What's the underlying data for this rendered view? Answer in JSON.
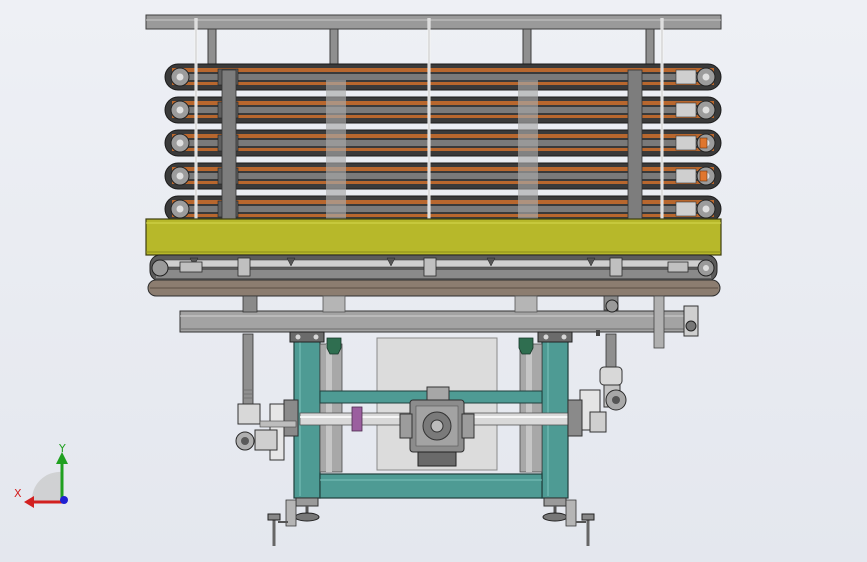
{
  "viewport": {
    "background_top": "#eef0f5",
    "background_bottom": "#e4e7ee"
  },
  "colors": {
    "frame_gray": "#8f8f8f",
    "frame_dark": "#4a4a4a",
    "belt_orange": "#b8672e",
    "belt_dark": "#3a3a3a",
    "platform_yellow": "#b7b82a",
    "base_teal": "#4e9b94",
    "bolt_green": "#2f6e50",
    "motor_gray": "#8c8c8c"
  },
  "conveyor": {
    "tier_count": 5
  },
  "triad": {
    "x_label": "X",
    "y_label": "Y",
    "x_color": "#d22020",
    "y_color": "#20a020",
    "z_color": "#2020d2"
  }
}
